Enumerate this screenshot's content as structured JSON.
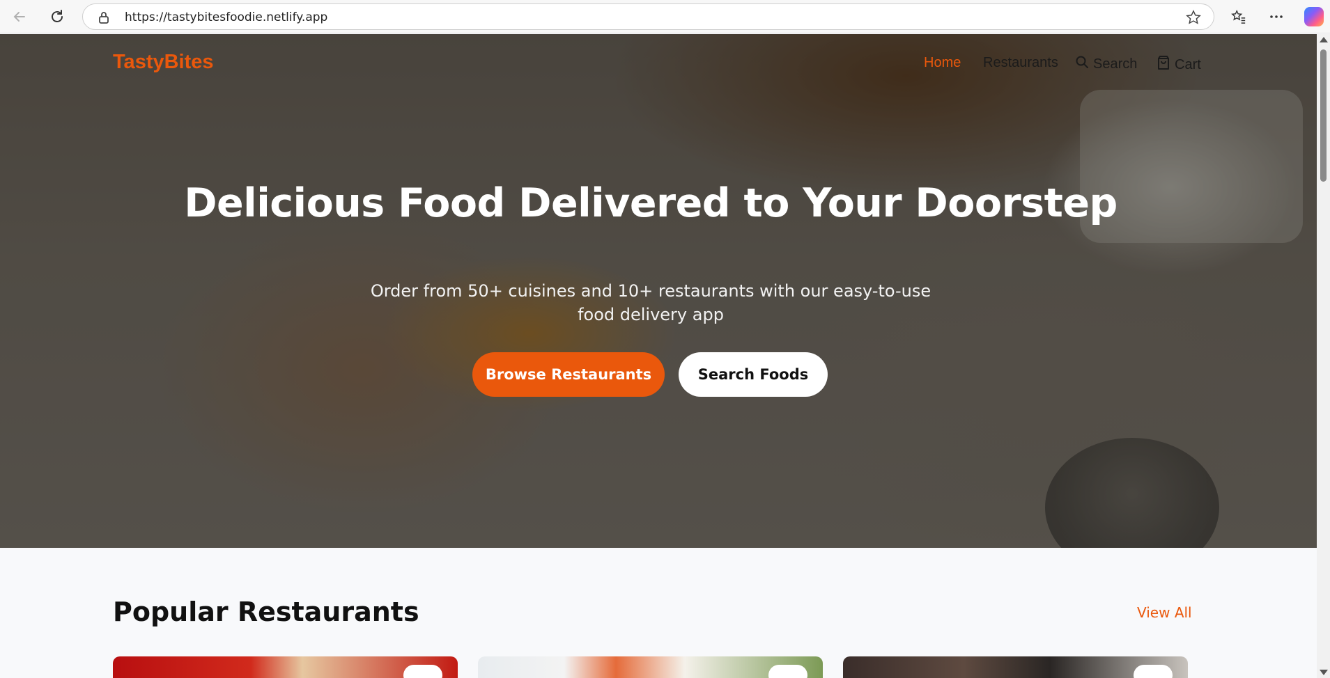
{
  "browser": {
    "url": "https://tastybitesfoodie.netlify.app"
  },
  "nav": {
    "logo": "TastyBites",
    "links": [
      {
        "label": "Home",
        "active": true
      },
      {
        "label": "Restaurants",
        "active": false
      },
      {
        "label": "Search",
        "icon": "search-icon",
        "active": false
      },
      {
        "label": "Cart",
        "icon": "shopping-bag-icon",
        "active": false
      }
    ]
  },
  "hero": {
    "title": "Delicious Food Delivered to Your Doorstep",
    "subtitle": "Order from 50+ cuisines and 10+ restaurants with our easy-to-use food delivery app",
    "primary_button": "Browse Restaurants",
    "secondary_button": "Search Foods"
  },
  "popular": {
    "title": "Popular Restaurants",
    "view_all": "View All"
  },
  "colors": {
    "accent": "#ea580c",
    "page_background": "#f8f9fb"
  }
}
